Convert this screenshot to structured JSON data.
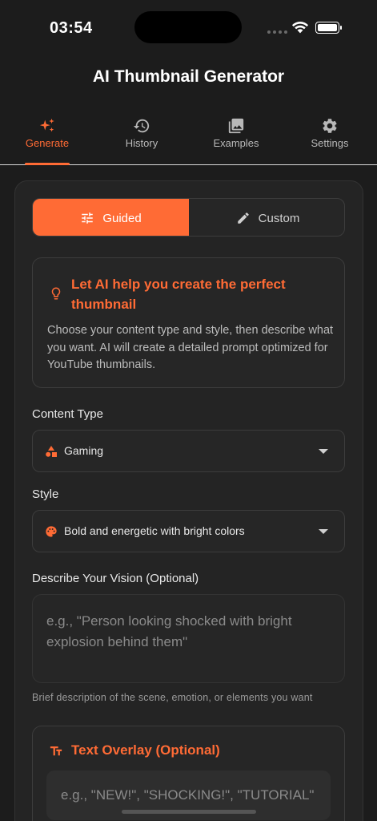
{
  "status_bar": {
    "time": "03:54"
  },
  "app": {
    "title": "AI Thumbnail Generator"
  },
  "tabs": [
    {
      "label": "Generate",
      "icon": "sparkle-icon",
      "active": true
    },
    {
      "label": "History",
      "icon": "history-icon",
      "active": false
    },
    {
      "label": "Examples",
      "icon": "image-icon",
      "active": false
    },
    {
      "label": "Settings",
      "icon": "gear-icon",
      "active": false
    }
  ],
  "mode_toggle": {
    "guided_label": "Guided",
    "custom_label": "Custom",
    "selected": "Guided"
  },
  "tip": {
    "title": "Let AI help you create the perfect thumbnail",
    "body": "Choose your content type and style, then describe what you want. AI will create a detailed prompt optimized for YouTube thumbnails."
  },
  "content_type": {
    "label": "Content Type",
    "value": "Gaming"
  },
  "style": {
    "label": "Style",
    "value": "Bold and energetic with bright colors"
  },
  "vision": {
    "label": "Describe Your Vision (Optional)",
    "placeholder": "e.g., \"Person looking shocked with bright explosion behind them\"",
    "helper": "Brief description of the scene, emotion, or elements you want"
  },
  "text_overlay": {
    "title": "Text Overlay (Optional)",
    "placeholder": "e.g., \"NEW!\", \"SHOCKING!\", \"TUTORIAL\""
  },
  "colors": {
    "accent": "#ff6b35",
    "background": "#1c1c1c",
    "surface": "#262626"
  }
}
